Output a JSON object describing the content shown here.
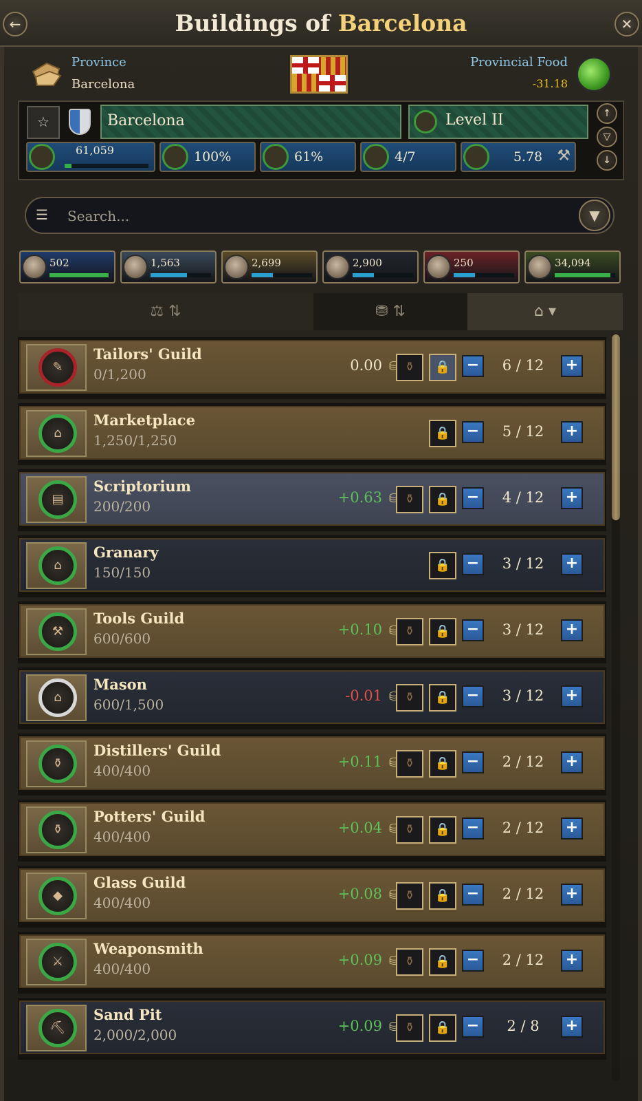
{
  "window": {
    "title_prefix": "Buildings of",
    "title_city": "Barcelona",
    "back_icon": "arrow-left-icon",
    "close_icon": "close-icon"
  },
  "province": {
    "label": "Province",
    "name": "Barcelona",
    "food_label": "Provincial Food",
    "food_value": "-31.18"
  },
  "city": {
    "name": "Barcelona",
    "level": "Level II",
    "stats": [
      {
        "icon": "population-icon",
        "value": "61,059",
        "progress": 0.08
      },
      {
        "icon": "building-slots-icon",
        "value": "100%"
      },
      {
        "icon": "control-icon",
        "value": "61%"
      },
      {
        "icon": "trade-icon",
        "value": "4/7"
      },
      {
        "icon": "production-icon",
        "value": "5.78"
      }
    ]
  },
  "search": {
    "placeholder": "Search..."
  },
  "pop_classes": [
    {
      "value": "502",
      "color": "#1f3a6a",
      "fill_color": "#3ab04a",
      "progress": 0.98
    },
    {
      "value": "1,563",
      "color": "#3a4a5a",
      "fill_color": "#2aa0d0",
      "progress": 0.6
    },
    {
      "value": "2,699",
      "color": "#5a4a28",
      "fill_color": "#2aa0d0",
      "progress": 0.35
    },
    {
      "value": "2,900",
      "color": "#22262c",
      "fill_color": "#2aa0d0",
      "progress": 0.35
    },
    {
      "value": "250",
      "color": "#6a2226",
      "fill_color": "#2aa0d0",
      "progress": 0.35
    },
    {
      "value": "34,094",
      "color": "#3a4a22",
      "fill_color": "#3ab04a",
      "progress": 0.92
    }
  ],
  "buildings": [
    {
      "name": "Tailors' Guild",
      "capacity": "0/1,200",
      "income": "0.00",
      "income_kind": "zero",
      "count": "6 / 12",
      "ring": "red",
      "glyph": "✎",
      "bg": "gold",
      "bag": true,
      "lock_light": true
    },
    {
      "name": "Marketplace",
      "capacity": "1,250/1,250",
      "income": "",
      "income_kind": "none",
      "count": "5 / 12",
      "ring": "green",
      "glyph": "⌂",
      "bg": "gold",
      "bag": false,
      "lock_light": false
    },
    {
      "name": "Scriptorium",
      "capacity": "200/200",
      "income": "+0.63",
      "income_kind": "pos",
      "count": "4 / 12",
      "ring": "green",
      "glyph": "▤",
      "bg": "sel",
      "bag": true,
      "lock_light": false
    },
    {
      "name": "Granary",
      "capacity": "150/150",
      "income": "",
      "income_kind": "none",
      "count": "3 / 12",
      "ring": "green",
      "glyph": "⌂",
      "bg": "slate",
      "bag": false,
      "lock_light": false
    },
    {
      "name": "Tools Guild",
      "capacity": "600/600",
      "income": "+0.10",
      "income_kind": "pos",
      "count": "3 / 12",
      "ring": "green",
      "glyph": "⚒",
      "bg": "gold",
      "bag": true,
      "lock_light": false
    },
    {
      "name": "Mason",
      "capacity": "600/1,500",
      "income": "-0.01",
      "income_kind": "neg",
      "count": "3 / 12",
      "ring": "white",
      "glyph": "⌂",
      "bg": "slate",
      "bag": true,
      "lock_light": false
    },
    {
      "name": "Distillers' Guild",
      "capacity": "400/400",
      "income": "+0.11",
      "income_kind": "pos",
      "count": "2 / 12",
      "ring": "green",
      "glyph": "⚱",
      "bg": "gold",
      "bag": true,
      "lock_light": false
    },
    {
      "name": "Potters' Guild",
      "capacity": "400/400",
      "income": "+0.04",
      "income_kind": "pos",
      "count": "2 / 12",
      "ring": "green",
      "glyph": "⚱",
      "bg": "gold",
      "bag": true,
      "lock_light": false
    },
    {
      "name": "Glass Guild",
      "capacity": "400/400",
      "income": "+0.08",
      "income_kind": "pos",
      "count": "2 / 12",
      "ring": "green",
      "glyph": "◆",
      "bg": "gold",
      "bag": true,
      "lock_light": false
    },
    {
      "name": "Weaponsmith",
      "capacity": "400/400",
      "income": "+0.09",
      "income_kind": "pos",
      "count": "2 / 12",
      "ring": "green",
      "glyph": "⚔",
      "bg": "gold",
      "bag": true,
      "lock_light": false
    },
    {
      "name": "Sand Pit",
      "capacity": "2,000/2,000",
      "income": "+0.09",
      "income_kind": "pos",
      "count": "2 / 8",
      "ring": "green",
      "glyph": "⛏",
      "bg": "slate",
      "bag": true,
      "lock_light": false
    }
  ],
  "scroll_position": 0.25
}
